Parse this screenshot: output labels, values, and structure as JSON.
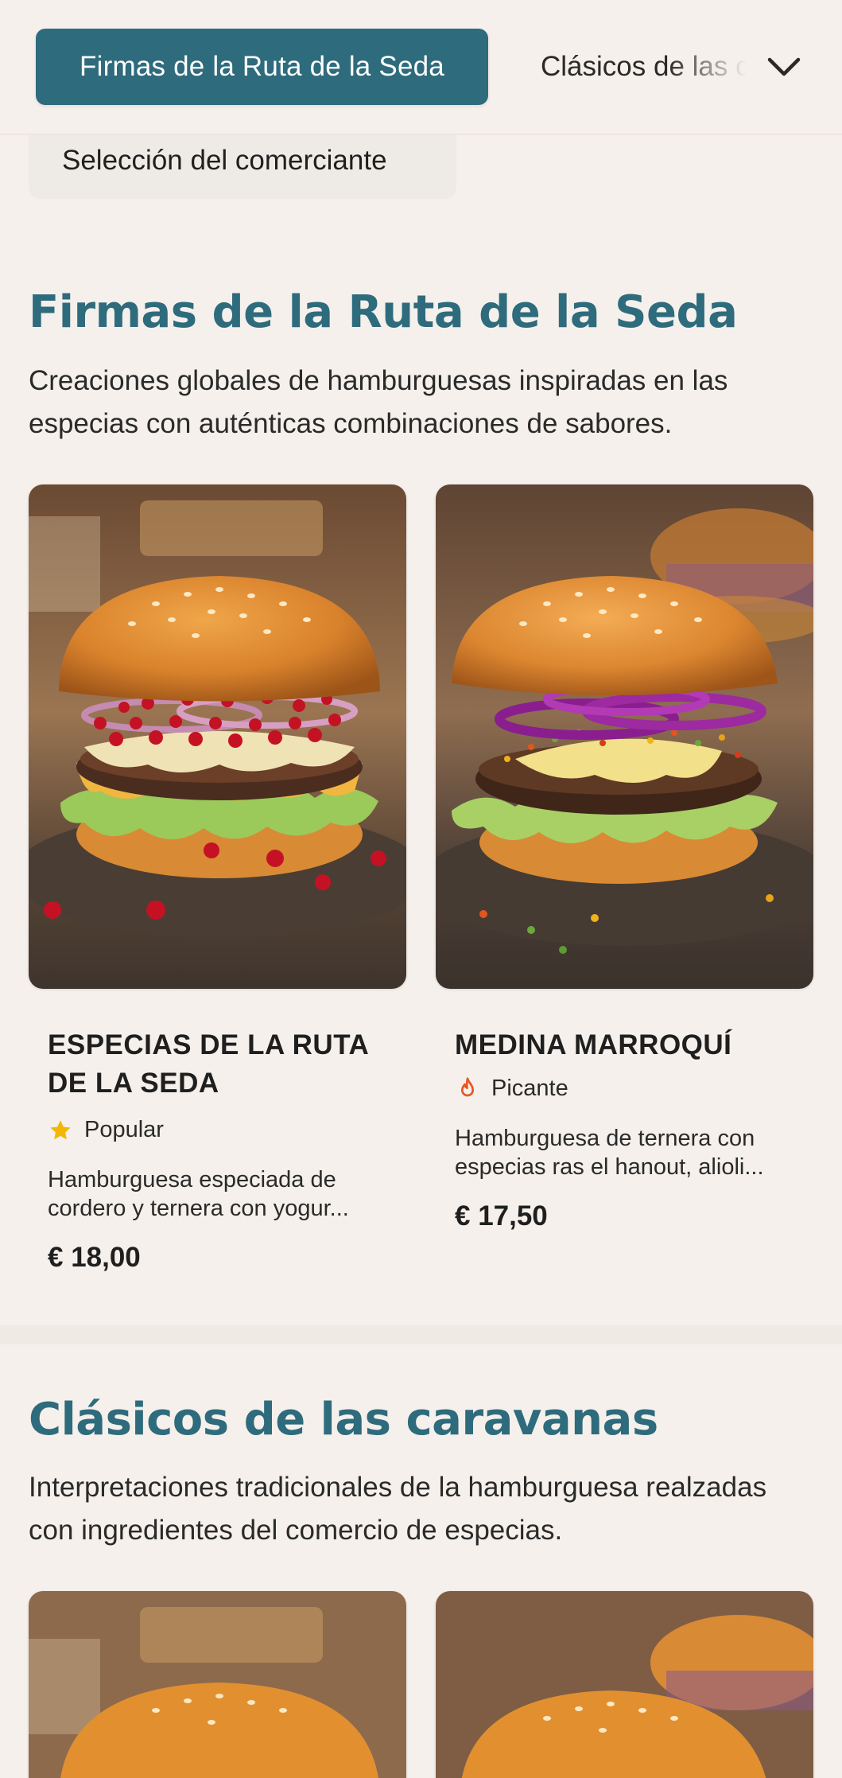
{
  "nav": {
    "active_tab": "Firmas de la Ruta de la Seda",
    "next_tab": "Clásicos de las caravanas",
    "expand_icon": "chevron-down-icon"
  },
  "chip": {
    "label": "Selección del comerciante"
  },
  "sections": [
    {
      "title": "Firmas de la Ruta de la Seda",
      "description": "Creaciones globales de hamburguesas inspiradas en las especias con auténticas combinaciones de sabores.",
      "items": [
        {
          "name": "ESPECIAS DE LA RUTA DE LA SEDA",
          "tag": "Popular",
          "tag_icon": "star-icon",
          "description": "Hamburguesa especiada de cordero y ternera con yogur...",
          "price": "€ 18,00"
        },
        {
          "name": "MEDINA MARROQUÍ",
          "tag": "Picante",
          "tag_icon": "flame-icon",
          "description": "Hamburguesa de ternera con especias ras el hanout, alioli...",
          "price": "€ 17,50"
        }
      ]
    },
    {
      "title": "Clásicos de las caravanas",
      "description": "Interpretaciones tradicionales de la hamburguesa realzadas con ingredientes del comercio de especias."
    }
  ],
  "colors": {
    "accent": "#2e6b7c",
    "background": "#f5f0eb",
    "star": "#f2b705",
    "flame": "#e8561e"
  }
}
